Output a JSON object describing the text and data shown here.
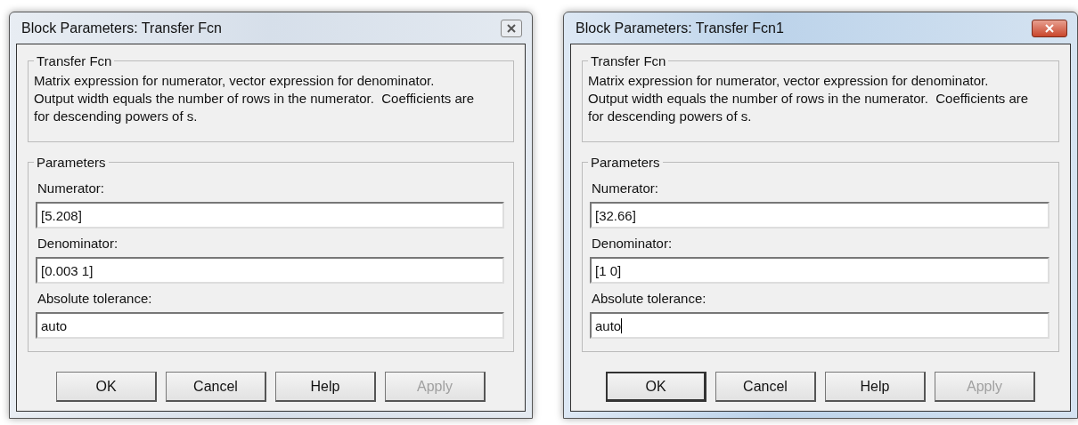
{
  "dialogs": [
    {
      "title": "Block Parameters: Transfer Fcn",
      "active": false,
      "description": {
        "title": "Transfer Fcn",
        "text": "Matrix expression for numerator, vector expression for denominator.\nOutput width equals the number of rows in the numerator.  Coefficients are\nfor descending powers of s."
      },
      "parameters": {
        "title": "Parameters",
        "fields": [
          {
            "label": "Numerator:",
            "value": "[5.208]",
            "focused": false
          },
          {
            "label": "Denominator:",
            "value": "[0.003 1]",
            "focused": false
          },
          {
            "label": "Absolute tolerance:",
            "value": "auto",
            "focused": false
          }
        ]
      },
      "buttons": [
        {
          "label": "OK",
          "default": false,
          "disabled": false
        },
        {
          "label": "Cancel",
          "default": false,
          "disabled": false
        },
        {
          "label": "Help",
          "default": false,
          "disabled": false
        },
        {
          "label": "Apply",
          "default": false,
          "disabled": true
        }
      ]
    },
    {
      "title": "Block Parameters: Transfer Fcn1",
      "active": true,
      "description": {
        "title": "Transfer Fcn",
        "text": "Matrix expression for numerator, vector expression for denominator.\nOutput width equals the number of rows in the numerator.  Coefficients are\nfor descending powers of s."
      },
      "parameters": {
        "title": "Parameters",
        "fields": [
          {
            "label": "Numerator:",
            "value": "[32.66]",
            "focused": false
          },
          {
            "label": "Denominator:",
            "value": "[1 0]",
            "focused": false
          },
          {
            "label": "Absolute tolerance:",
            "value": "auto",
            "focused": true
          }
        ]
      },
      "buttons": [
        {
          "label": "OK",
          "default": true,
          "disabled": false
        },
        {
          "label": "Cancel",
          "default": false,
          "disabled": false
        },
        {
          "label": "Help",
          "default": false,
          "disabled": false
        },
        {
          "label": "Apply",
          "default": false,
          "disabled": true
        }
      ]
    }
  ]
}
